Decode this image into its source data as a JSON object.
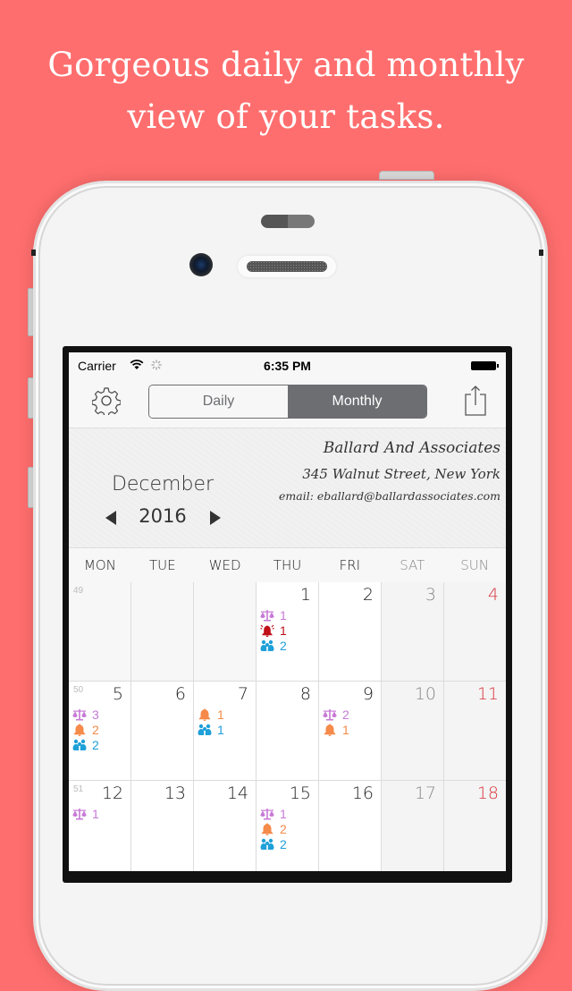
{
  "headline": {
    "line1": "Gorgeous daily and monthly",
    "line2": "view of your tasks."
  },
  "colors": {
    "background": "#ff6e6e",
    "segment_active": "#6d6e72",
    "sunday": "#d9343c",
    "scale": "#c77ad6",
    "bell": "#f58a4a",
    "alarm": "#c0101a",
    "people": "#1ea0d9"
  },
  "statusbar": {
    "carrier": "Carrier",
    "time": "6:35 PM",
    "wifi_icon": "wifi-icon",
    "activity_icon": "activity-spinner-icon",
    "battery_icon": "battery-icon"
  },
  "navbar": {
    "settings_icon": "gear-icon",
    "segments": [
      {
        "label": "Daily",
        "selected": false
      },
      {
        "label": "Monthly",
        "selected": true
      }
    ],
    "share_icon": "share-icon"
  },
  "calendar_header": {
    "month": "December",
    "year": "2016",
    "prev_icon": "triangle-left-icon",
    "next_icon": "triangle-right-icon"
  },
  "business": {
    "name": "Ballard And Associates",
    "address": "345 Walnut Street, New York",
    "email": "email: eballard@ballardassociates.com"
  },
  "weekdays": [
    "MON",
    "TUE",
    "WED",
    "THU",
    "FRI",
    "SAT",
    "SUN"
  ],
  "weeks": [
    {
      "week_number": "49",
      "days": [
        {
          "day": "",
          "tasks": []
        },
        {
          "day": "",
          "tasks": []
        },
        {
          "day": "",
          "tasks": []
        },
        {
          "day": "1",
          "tasks": [
            {
              "icon": "scale",
              "count": "1"
            },
            {
              "icon": "alarm",
              "count": "1"
            },
            {
              "icon": "people",
              "count": "2"
            }
          ]
        },
        {
          "day": "2",
          "tasks": []
        },
        {
          "day": "3",
          "tasks": []
        },
        {
          "day": "4",
          "tasks": []
        }
      ]
    },
    {
      "week_number": "50",
      "days": [
        {
          "day": "5",
          "tasks": [
            {
              "icon": "scale",
              "count": "3"
            },
            {
              "icon": "bell",
              "count": "2"
            },
            {
              "icon": "people",
              "count": "2"
            }
          ]
        },
        {
          "day": "6",
          "tasks": []
        },
        {
          "day": "7",
          "tasks": [
            {
              "icon": "bell",
              "count": "1"
            },
            {
              "icon": "people",
              "count": "1"
            }
          ]
        },
        {
          "day": "8",
          "tasks": []
        },
        {
          "day": "9",
          "tasks": [
            {
              "icon": "scale",
              "count": "2"
            },
            {
              "icon": "bell",
              "count": "1"
            }
          ]
        },
        {
          "day": "10",
          "tasks": []
        },
        {
          "day": "11",
          "tasks": []
        }
      ]
    },
    {
      "week_number": "51",
      "days": [
        {
          "day": "12",
          "tasks": [
            {
              "icon": "scale",
              "count": "1"
            }
          ]
        },
        {
          "day": "13",
          "tasks": []
        },
        {
          "day": "14",
          "tasks": []
        },
        {
          "day": "15",
          "tasks": [
            {
              "icon": "scale",
              "count": "1"
            },
            {
              "icon": "bell",
              "count": "2"
            },
            {
              "icon": "people",
              "count": "2"
            }
          ]
        },
        {
          "day": "16",
          "tasks": []
        },
        {
          "day": "17",
          "tasks": []
        },
        {
          "day": "18",
          "tasks": []
        }
      ]
    }
  ]
}
